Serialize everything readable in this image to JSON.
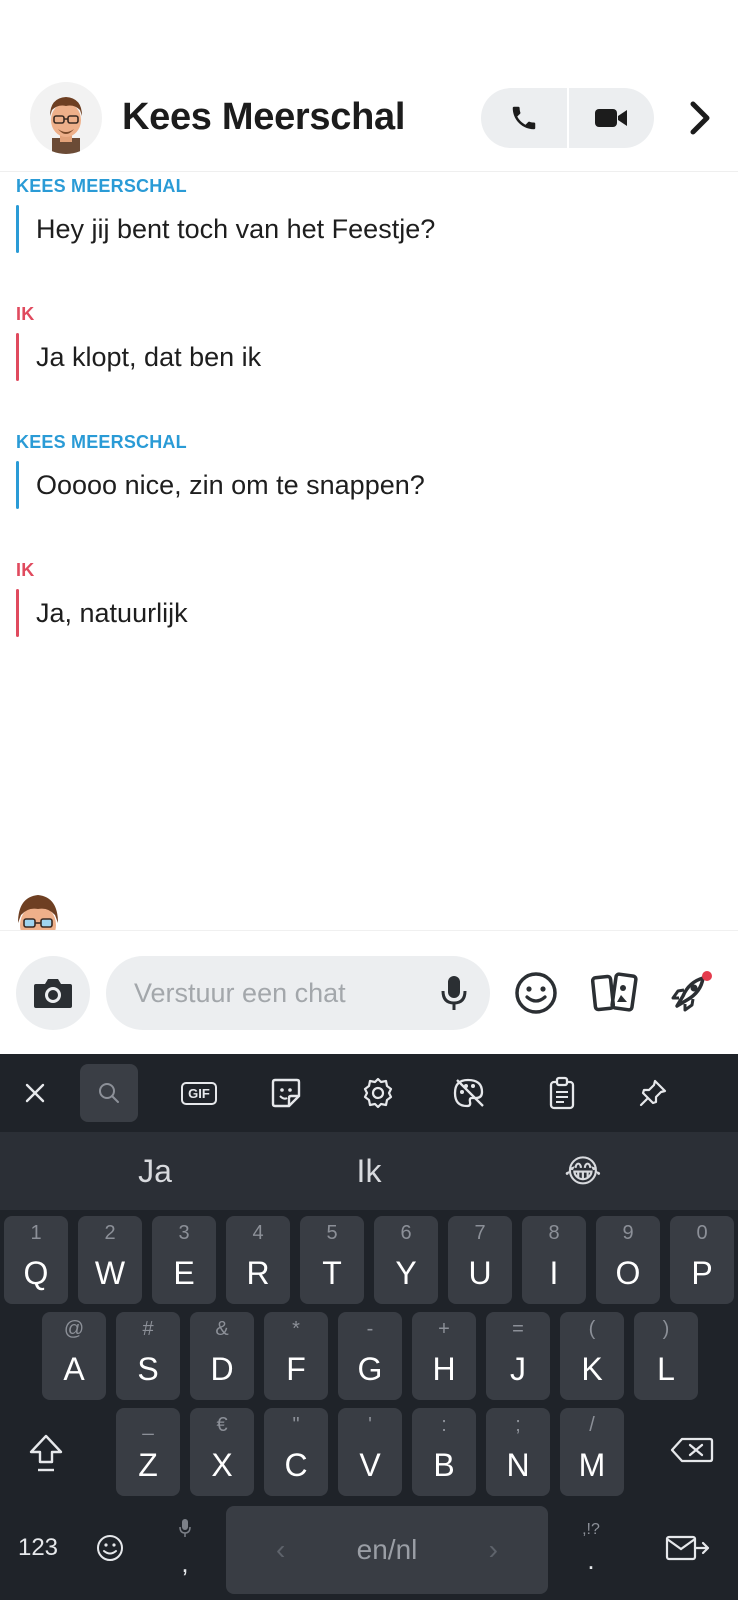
{
  "header": {
    "contact_name": "Kees Meerschal",
    "avatar_icon": "bitmoji-avatar",
    "actions": [
      "phone-icon",
      "video-camera-icon",
      "chevron-right-icon"
    ]
  },
  "messages": [
    {
      "sender": "KEES MEERSCHAL",
      "text": "Hey jij bent toch van het Feestje?",
      "from_me": false
    },
    {
      "sender": "IK",
      "text": "Ja klopt, dat ben ik",
      "from_me": true
    },
    {
      "sender": "KEES MEERSCHAL",
      "text": "Ooooo nice, zin om te snappen?",
      "from_me": false
    },
    {
      "sender": "IK",
      "text": "Ja, natuurlijk",
      "from_me": true
    }
  ],
  "input": {
    "placeholder": "Verstuur een chat",
    "value": ""
  },
  "colors": {
    "them": "#2a9bd6",
    "me": "#e04a5e",
    "keyboard_bg": "#1f2329",
    "key_bg": "#393d44"
  },
  "keyboard": {
    "toolbar": [
      "close-icon",
      "search-icon",
      "gif-icon",
      "sticker-icon",
      "settings-icon",
      "palette-icon",
      "clipboard-icon",
      "pin-icon"
    ],
    "gif_label": "GIF",
    "suggestions": [
      "Ja",
      "Ik",
      "😂"
    ],
    "row1": [
      {
        "k": "Q",
        "a": "1"
      },
      {
        "k": "W",
        "a": "2"
      },
      {
        "k": "E",
        "a": "3"
      },
      {
        "k": "R",
        "a": "4"
      },
      {
        "k": "T",
        "a": "5"
      },
      {
        "k": "Y",
        "a": "6"
      },
      {
        "k": "U",
        "a": "7"
      },
      {
        "k": "I",
        "a": "8"
      },
      {
        "k": "O",
        "a": "9"
      },
      {
        "k": "P",
        "a": "0"
      }
    ],
    "row2": [
      {
        "k": "A",
        "a": "@"
      },
      {
        "k": "S",
        "a": "#"
      },
      {
        "k": "D",
        "a": "&"
      },
      {
        "k": "F",
        "a": "*"
      },
      {
        "k": "G",
        "a": "-"
      },
      {
        "k": "H",
        "a": "+"
      },
      {
        "k": "J",
        "a": "="
      },
      {
        "k": "K",
        "a": "("
      },
      {
        "k": "L",
        "a": ")"
      }
    ],
    "row3": [
      {
        "k": "Z",
        "a": "_"
      },
      {
        "k": "X",
        "a": "€"
      },
      {
        "k": "C",
        "a": "\""
      },
      {
        "k": "V",
        "a": "'"
      },
      {
        "k": "B",
        "a": ":"
      },
      {
        "k": "N",
        "a": ";"
      },
      {
        "k": "M",
        "a": "/"
      }
    ],
    "numbers_label": "123",
    "comma": ",",
    "space_label": "en/nl",
    "space_left": "‹",
    "space_right": "›",
    "period": ".",
    "period_alt": ",!?"
  }
}
